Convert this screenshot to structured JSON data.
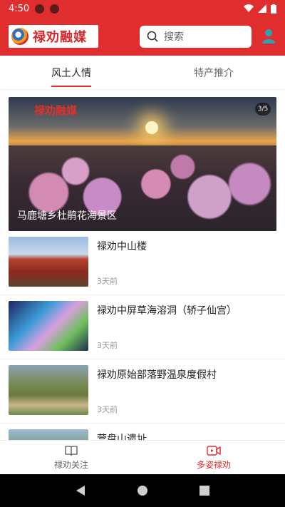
{
  "status_bar": {
    "time": "4:50"
  },
  "header": {
    "logo_text": "禄劝融媒",
    "search_placeholder": "搜索"
  },
  "tabs": [
    {
      "label": "风土人情",
      "active": true
    },
    {
      "label": "特产推介",
      "active": false
    }
  ],
  "banner": {
    "caption": "马鹿塘乡杜鹃花海景区",
    "counter": "3/5",
    "watermark": "禄劝融媒"
  },
  "articles": [
    {
      "title": "禄劝中山楼",
      "time": "3天前"
    },
    {
      "title": "禄劝中屏草海溶洞（轿子仙宫）",
      "time": "3天前"
    },
    {
      "title": "禄劝原始部落野温泉度假村",
      "time": "3天前"
    },
    {
      "title": "营盘山遗址",
      "time": ""
    }
  ],
  "bottom_nav": [
    {
      "label": "禄劝关注",
      "active": false
    },
    {
      "label": "多姿禄劝",
      "active": true
    }
  ],
  "colors": {
    "brand": "#e02d2d",
    "text_muted": "#999999"
  }
}
